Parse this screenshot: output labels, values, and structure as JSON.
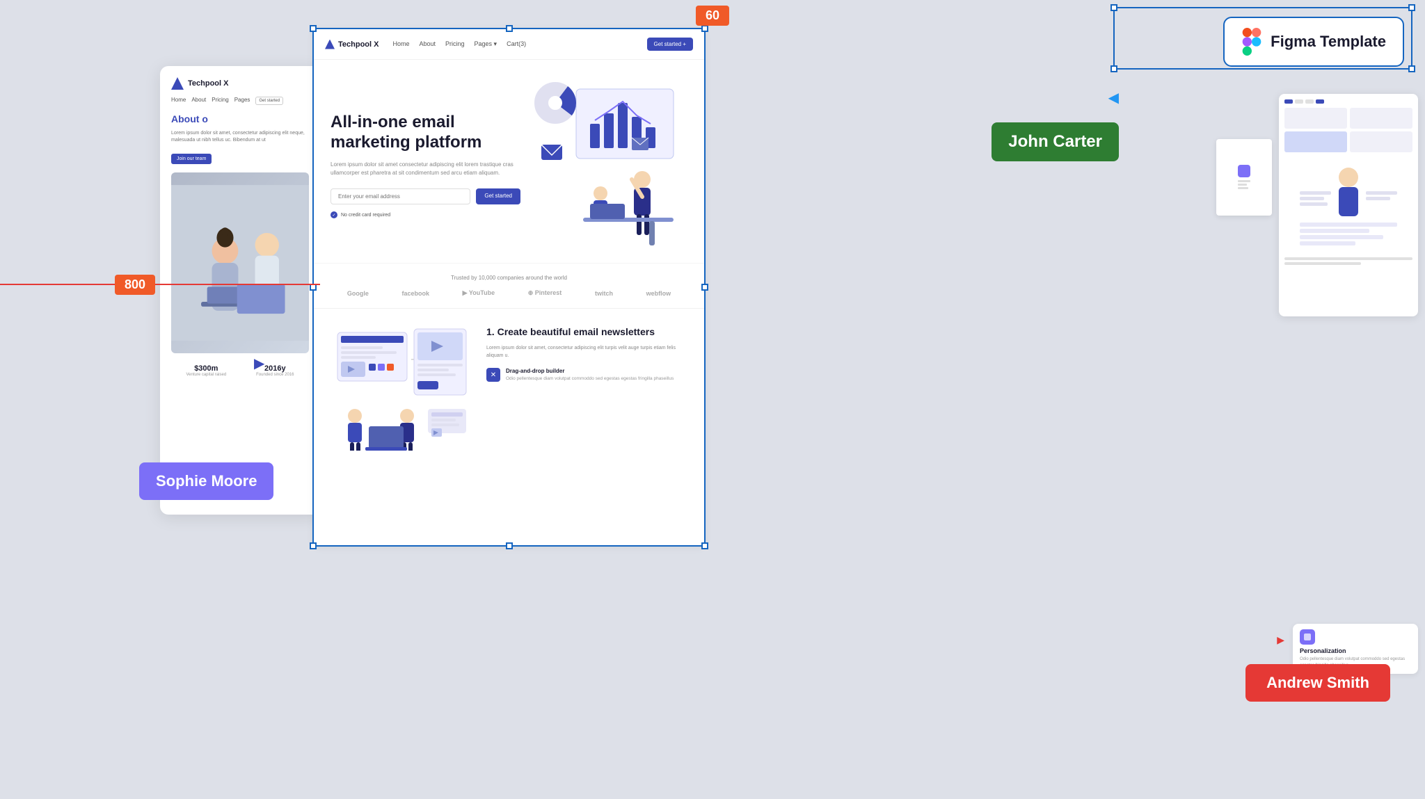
{
  "canvas": {
    "background_color": "#dde0e8"
  },
  "measure": {
    "top_badge": "60",
    "left_badge": "800"
  },
  "figma_badge": {
    "logo_label": "Figma",
    "title": "Figma Template"
  },
  "user_badges": {
    "sophie": "Sophie Moore",
    "john": "John Carter",
    "andrew": "Andrew Smith"
  },
  "site": {
    "nav": {
      "logo": "Techpool X",
      "links": [
        "Home",
        "About",
        "Pricing",
        "Pages ▾",
        "Cart(3)"
      ],
      "cta": "Get started +"
    },
    "hero": {
      "title": "All-in-one email marketing platform",
      "description": "Lorem ipsum dolor sit amet consectetur adipiscing elit lorem trastique cras ullamcorper est pharetra at sit condimentum sed arcu etiam aliquam.",
      "input_placeholder": "Enter your email address",
      "cta_button": "Get started",
      "note": "No credit card required"
    },
    "trusted": {
      "title": "Trusted by 10,000 companies around the world",
      "logos": [
        "Google",
        "facebook",
        "▶ YouTube",
        "Pinterest",
        "twitch",
        "webflow"
      ]
    },
    "feature": {
      "number": "1.",
      "title": "Create beautiful email newsletters",
      "description": "Lorem ipsum dolor sit amet, consectetur adipiscing elit turpis velit auge turpis etiam felis aliquam u.",
      "items": [
        {
          "name": "Drag-and-drop builder",
          "desc": "Odio pellentesque diam volutpat commoddo sed egestas egestas fringilla phaseillus"
        }
      ]
    },
    "personalization": {
      "title": "Personalization",
      "desc": "Odio pellentesque diam volutpat commoddo sed egestas egestas fringilla phaseillus"
    },
    "left_partial": {
      "logo": "Techpool X",
      "about_title": "About o",
      "text": "Lorem ipsum dolor sit amet, consectetur adipiscing elit neque, malesuada ut nibh tellus uc. Bibendum at ut",
      "btn_label": "Join our team",
      "stats": [
        {
          "value": "$300m",
          "label": "Venture capital raised"
        },
        {
          "value": "2016y",
          "label": "Founded since 2016"
        }
      ]
    }
  }
}
